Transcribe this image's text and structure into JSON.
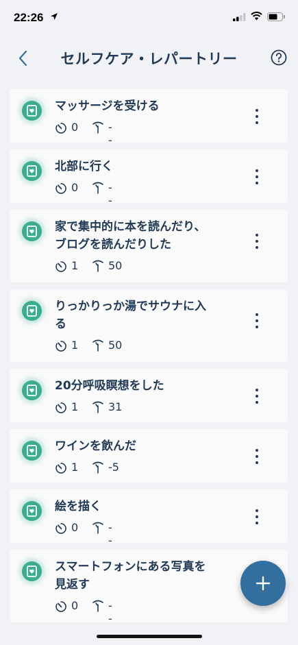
{
  "status_bar": {
    "time": "22:26"
  },
  "header": {
    "title": "セルフケア・レパートリー"
  },
  "items": [
    {
      "title_line1": "マッサージを受ける",
      "title_line2": "",
      "count": "0",
      "value": "--"
    },
    {
      "title_line1": "北部に行く",
      "title_line2": "",
      "count": "0",
      "value": "--"
    },
    {
      "title_line1": "家で集中的に本を読んだり、",
      "title_line2": "ブログを読んだりした",
      "count": "1",
      "value": "50"
    },
    {
      "title_line1": "りっかりっか湯でサウナに入",
      "title_line2": "る",
      "count": "1",
      "value": "50"
    },
    {
      "title_line1": "20分呼吸瞑想をした",
      "title_line2": "",
      "count": "1",
      "value": "31"
    },
    {
      "title_line1": "ワインを飲んだ",
      "title_line2": "",
      "count": "1",
      "value": "-5"
    },
    {
      "title_line1": "絵を描く",
      "title_line2": "",
      "count": "0",
      "value": "--"
    },
    {
      "title_line1": "スマートフォンにある写真を",
      "title_line2": "見返す",
      "count": "0",
      "value": "--"
    }
  ],
  "icons": {
    "card": "self-care-card-icon",
    "count": "timer-icon",
    "value": "thermometer-icon",
    "menu": "more-vertical-icon",
    "fab": "plus-icon"
  },
  "colors": {
    "accent": "#3aae8f",
    "fab": "#336f9e",
    "text": "#213a55",
    "background": "#f1f2f5",
    "card": "#fafafb"
  }
}
